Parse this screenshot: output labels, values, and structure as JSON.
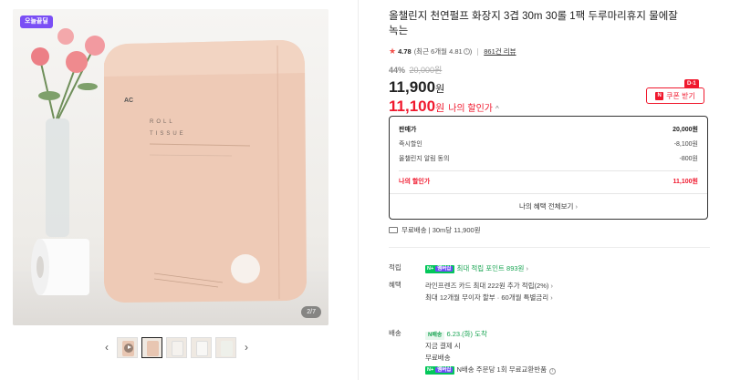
{
  "gallery": {
    "badge": "오늘끝딜",
    "counter": "2/7",
    "package_text_1": "ROLL",
    "package_text_2": "TISSUE",
    "package_mark": "AC",
    "thumbs": [
      "video",
      "pack-front",
      "roll-pair",
      "roll-detail",
      "pack-side"
    ],
    "active_thumb": 1
  },
  "product": {
    "title": "올챌린지 천연펄프 화장지 3겹 30m 30롤 1팩 두루마리휴지 물에잘녹는",
    "rating": "4.78",
    "recent_rating": "(최근 6개월 4.81",
    "review_count": "861건 리뷰",
    "discount_rate": "44%",
    "original_price": "20,000원",
    "price": "11,900",
    "price_unit": "원",
    "my_price": "11,100",
    "my_price_unit": "원",
    "my_price_label": "나의 할인가",
    "coupon_label": "쿠폰 받기",
    "coupon_badge": "D-1"
  },
  "breakdown": {
    "rows": [
      {
        "label": "판매가",
        "value": "20,000원"
      },
      {
        "label": "즉시할인",
        "value": "-8,100원"
      },
      {
        "label": "올챌린지 알림 동의",
        "value": "-800원"
      }
    ],
    "total_label": "나의 할인가",
    "total_value": "11,100원",
    "more_label": "나의 혜택 전체보기"
  },
  "shipping_summary": "무료배송 | 30m당 11,900원",
  "points": {
    "label": "적립",
    "badge_n": "N+",
    "badge_plus": "멤버십",
    "text": "최대 적립 포인트 893원"
  },
  "benefits": {
    "label": "혜택",
    "line1": "라인프렌즈 카드 최대 222원 추가 적립(2%)",
    "line2": "최대 12개월 무이자 할부 · 60개월 특별금리"
  },
  "delivery": {
    "label": "배송",
    "badge": "N배송",
    "eta": "6.23.(화) 도착",
    "line2": "지금 결제 시",
    "line3": "무료배송",
    "line4": "N배송 주문당 1회 무료교환반품"
  },
  "colors": {
    "accent_red": "#f0192e",
    "badge_purple": "#7a4ef5",
    "npay_green": "#03c75a"
  }
}
